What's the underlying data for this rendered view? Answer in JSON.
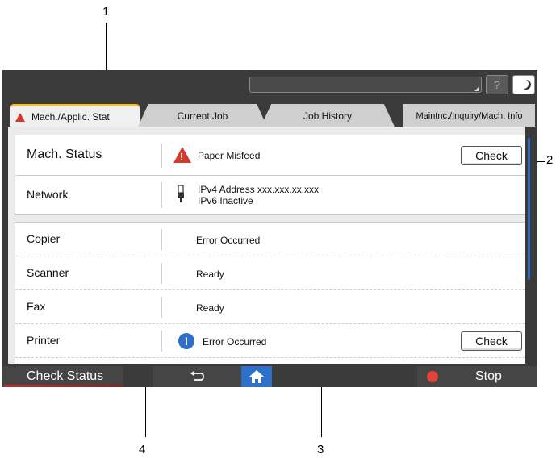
{
  "callouts": {
    "c1": "1",
    "c2": "2",
    "c3": "3",
    "c4": "4"
  },
  "topbar": {
    "help_label": "?"
  },
  "tabs": [
    {
      "label": "Mach./Applic. Stat"
    },
    {
      "label": "Current Job"
    },
    {
      "label": "Job History"
    },
    {
      "label": "Maintnc./Inquiry/Mach. Info"
    }
  ],
  "machine": {
    "status_label": "Mach. Status",
    "status_value": "Paper Misfeed",
    "check_label": "Check",
    "network_label": "Network",
    "ipv4": "IPv4 Address xxx.xxx.xx.xxx",
    "ipv6": "IPv6 Inactive"
  },
  "functions": [
    {
      "name": "Copier",
      "status": "Error Occurred"
    },
    {
      "name": "Scanner",
      "status": "Ready"
    },
    {
      "name": "Fax",
      "status": "Ready"
    },
    {
      "name": "Printer",
      "status": "Error Occurred",
      "check_label": "Check"
    }
  ],
  "bottombar": {
    "check_status": "Check Status",
    "stop": "Stop"
  },
  "colors": {
    "accent": "#2d6fc9",
    "warning": "#d33a2c",
    "tab_highlight": "#f0c030"
  },
  "icons": [
    "warning-icon",
    "usb-icon",
    "info-icon",
    "back-icon",
    "home-icon",
    "stop-icon",
    "help-icon",
    "moon-icon"
  ]
}
